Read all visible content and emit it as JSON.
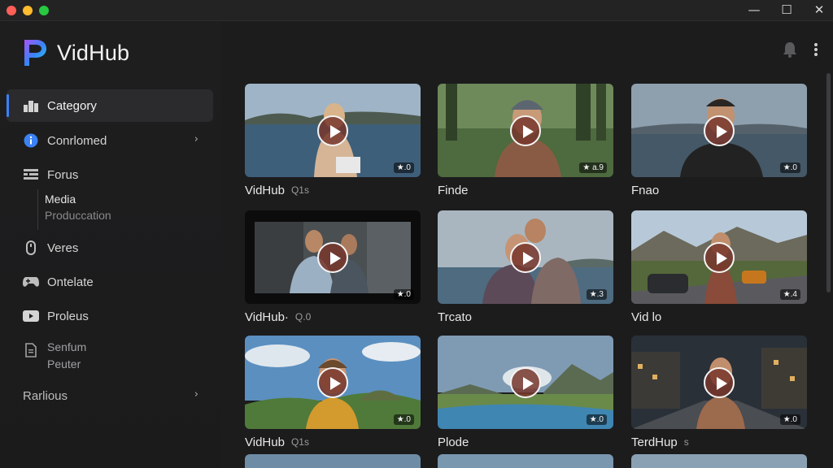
{
  "window": {
    "minimize_glyph": "—",
    "maximize_glyph": "☐",
    "close_glyph": "✕"
  },
  "app": {
    "name": "VidHub"
  },
  "sidebar": {
    "items": [
      {
        "label": "Category",
        "icon": "category-icon",
        "active": true
      },
      {
        "label": "Conrlomed",
        "icon": "info-icon",
        "chevron": true
      },
      {
        "label": "Forus",
        "icon": "grid-icon"
      },
      {
        "sub1": "Media",
        "sub2": "Produccation"
      },
      {
        "label": "Veres",
        "icon": "mouse-icon"
      },
      {
        "label": "Ontelate",
        "icon": "gamepad-icon"
      },
      {
        "label": "Proleus",
        "icon": "video-icon"
      },
      {
        "line1": "Senfum",
        "line2": "Peuter",
        "icon": "document-icon"
      },
      {
        "label": "Rarlious",
        "chevron": true
      }
    ],
    "chevron_glyph": "›"
  },
  "topbar": {
    "icons": [
      "bell-icon",
      "more-vert-icon"
    ]
  },
  "videos": [
    {
      "title": "VidHub",
      "meta": "Q1s",
      "duration": "★.0",
      "scene": "lake-woman"
    },
    {
      "title": "Finde",
      "meta": "",
      "duration": "★ a.9",
      "scene": "forest-beanie"
    },
    {
      "title": "Fnao",
      "meta": "",
      "duration": "★.0",
      "scene": "sea-man"
    },
    {
      "title": "VidHub·",
      "meta": "Q.0",
      "duration": "★.0",
      "scene": "room-two"
    },
    {
      "title": "Trcato",
      "meta": "",
      "duration": "★.3",
      "scene": "coast-couple"
    },
    {
      "title": "Vid lo",
      "meta": "",
      "duration": "★.4",
      "scene": "road-cars"
    },
    {
      "title": "VidHub",
      "meta": "Q1s",
      "duration": "★.0",
      "scene": "hills-boy"
    },
    {
      "title": "Plode",
      "meta": "",
      "duration": "★.0",
      "scene": "river-sun"
    },
    {
      "title": "TerdHup",
      "meta": "s",
      "duration": "★.0",
      "scene": "street-night"
    }
  ],
  "colors": {
    "accent": "#3b82f6",
    "play_fill": "#78372d",
    "background": "#1c1c1d"
  }
}
